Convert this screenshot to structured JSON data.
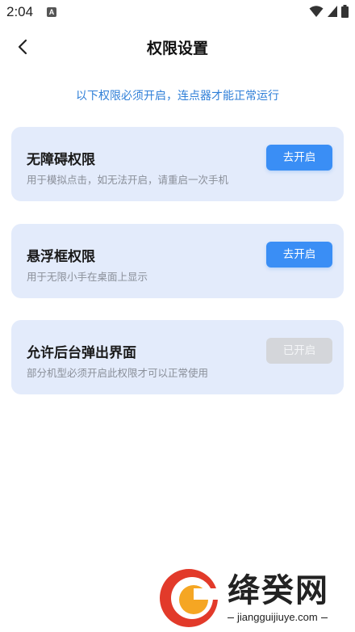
{
  "status_bar": {
    "time": "2:04",
    "icons": [
      "notification-a-icon",
      "wifi-icon",
      "signal-icon",
      "battery-icon"
    ]
  },
  "header": {
    "title": "权限设置",
    "back_icon": "chevron-left-icon"
  },
  "notice": "以下权限必须开启，连点器才能正常运行",
  "colors": {
    "accent": "#3a8ef5",
    "card_bg": "#e3ebfb",
    "notice_text": "#2f7fd8",
    "disabled_btn": "#d4d6da"
  },
  "permissions": [
    {
      "title": "无障碍权限",
      "desc": "用于模拟点击，如无法开启，请重启一次手机",
      "button": "去开启",
      "enabled": false
    },
    {
      "title": "悬浮框权限",
      "desc": "用于无限小手在桌面上显示",
      "button": "去开启",
      "enabled": false
    },
    {
      "title": "允许后台弹出界面",
      "desc": "部分机型必须开启此权限才可以正常使用",
      "button": "已开启",
      "enabled": true
    }
  ],
  "watermark": {
    "text": "绛癸网",
    "url": "jiangguijiuye.com"
  }
}
